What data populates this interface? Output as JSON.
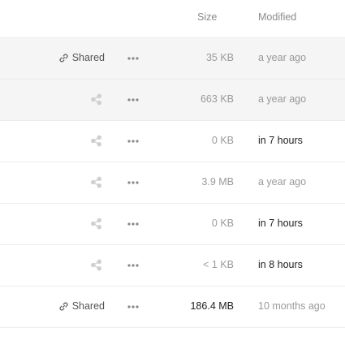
{
  "header": {
    "size_label": "Size",
    "modified_label": "Modified"
  },
  "rows": [
    {
      "shared": true,
      "shared_label": "Shared",
      "size": "35 KB",
      "size_dark": false,
      "modified": "a year ago",
      "modified_dark": false,
      "highlight": true
    },
    {
      "shared": false,
      "shared_label": "",
      "size": "663 KB",
      "size_dark": false,
      "modified": "a year ago",
      "modified_dark": false,
      "highlight": true
    },
    {
      "shared": false,
      "shared_label": "",
      "size": "0 KB",
      "size_dark": false,
      "modified": "in 7 hours",
      "modified_dark": true,
      "highlight": false
    },
    {
      "shared": false,
      "shared_label": "",
      "size": "3.9 MB",
      "size_dark": false,
      "modified": "a year ago",
      "modified_dark": false,
      "highlight": false
    },
    {
      "shared": false,
      "shared_label": "",
      "size": "0 KB",
      "size_dark": false,
      "modified": "in 7 hours",
      "modified_dark": true,
      "highlight": false
    },
    {
      "shared": false,
      "shared_label": "",
      "size": "< 1 KB",
      "size_dark": false,
      "modified": "in 8 hours",
      "modified_dark": true,
      "highlight": false
    },
    {
      "shared": true,
      "shared_label": "Shared",
      "size": "186.4 MB",
      "size_dark": true,
      "modified": "10 months ago",
      "modified_dark": false,
      "highlight": false
    }
  ],
  "icons": {
    "share": "share-icon",
    "link": "link-icon",
    "more": "more-options-icon"
  },
  "colors": {
    "highlight_bg": "#f5f5f5",
    "divider": "#ededed",
    "muted_text": "#999999",
    "dark_text": "#222222"
  }
}
